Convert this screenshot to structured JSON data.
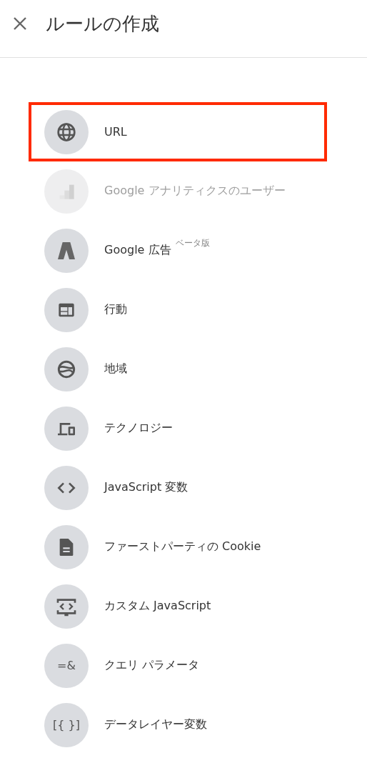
{
  "header": {
    "title": "ルールの作成"
  },
  "items": [
    {
      "kind": "globe",
      "label": "URL",
      "disabled": false,
      "highlighted": true
    },
    {
      "kind": "analytics",
      "label": "Google アナリティクスのユーザー",
      "disabled": true,
      "highlighted": false
    },
    {
      "kind": "ads",
      "label": "Google 広告",
      "badge": "ベータ版",
      "disabled": false,
      "highlighted": false
    },
    {
      "kind": "behavior",
      "label": "行動",
      "disabled": false,
      "highlighted": false
    },
    {
      "kind": "geo",
      "label": "地域",
      "disabled": false,
      "highlighted": false
    },
    {
      "kind": "devices",
      "label": "テクノロジー",
      "disabled": false,
      "highlighted": false
    },
    {
      "kind": "code",
      "label": "JavaScript 変数",
      "disabled": false,
      "highlighted": false
    },
    {
      "kind": "document",
      "label": "ファーストパーティの Cookie",
      "disabled": false,
      "highlighted": false
    },
    {
      "kind": "custom-code",
      "label": "カスタム JavaScript",
      "disabled": false,
      "highlighted": false
    },
    {
      "kind": "glyph",
      "glyph": "=&",
      "label": "クエリ パラメータ",
      "disabled": false,
      "highlighted": false
    },
    {
      "kind": "glyph",
      "glyph": "[{ }]",
      "label": "データレイヤー変数",
      "disabled": false,
      "highlighted": false
    }
  ]
}
